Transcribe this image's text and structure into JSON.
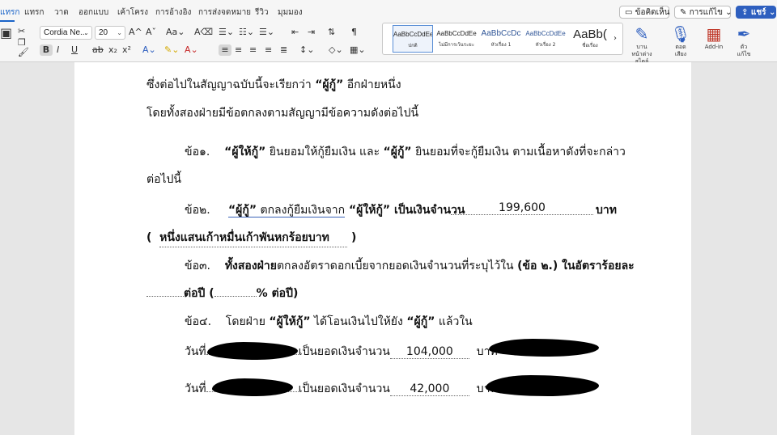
{
  "tabs": [
    "แทรก",
    "แทรก",
    "วาด",
    "ออกแบบ",
    "เค้าโครง",
    "การอ้างอิง",
    "การส่งจดหมาย",
    "รีวิว",
    "มุมมอง"
  ],
  "top_buttons": {
    "comments": "ข้อคิดเห็น",
    "editing": "การแก้ไข",
    "share": "แชร์"
  },
  "font": {
    "name": "Cordia Ne...",
    "size": "20"
  },
  "styles": [
    {
      "sample": "AaBbCcDdEe",
      "name": "ปกติ"
    },
    {
      "sample": "AaBbCcDdEe",
      "name": "ไม่มีการเว้นระยะ"
    },
    {
      "sample": "AaBbCcDc",
      "name": "หัวเรื่อง 1"
    },
    {
      "sample": "AaBbCcDdEe",
      "name": "หัวเรื่อง 2"
    },
    {
      "sample": "AaBb(",
      "name": "ชื่อเรื่อง"
    }
  ],
  "right_tools": {
    "pane": "บาน\nหน้าต่างสไตล์",
    "dictate": "ตอด\nเสียง",
    "addin": "Add-in",
    "editor": "ตัว\nแก้ไข"
  },
  "doc": {
    "l1_a": "ซึ่งต่อไปในสัญญาฉบับนี้จะเรียกว่า ",
    "l1_b": "“ผู้กู้”",
    "l1_c": " อีกฝ่ายหนึ่ง",
    "l2": "โดยทั้งสองฝ่ายมีข้อตกลงตามสัญญามีข้อความดังต่อไปนี้",
    "c1_num": "ข้อ๑.",
    "c1_a": "“ผู้ให้กู้”",
    "c1_b": " ยินยอมให้กู้ยืมเงิน และ ",
    "c1_c": "“ผู้กู้”",
    "c1_d": " ยินยอมที่จะกู้ยืมเงิน ตามเนื้อหาดังที่จะกล่าว",
    "c1_cont": "ต่อไปนี้",
    "c2_num": "ข้อ๒.",
    "c2_a": "“ผู้กู้”",
    "c2_b": "  ตกลงกู้ยืมเงินจาก",
    "c2_c": " “ผู้ให้กู้” เป็นเงินจำนวน",
    "c2_amount": "199,600",
    "c2_unit": "บาท",
    "c2_words_open": "(",
    "c2_words": "หนึ่งแสนเก้าหมื่นเก้าพันหกร้อยบาท",
    "c2_words_close": ")",
    "c3_num": "ข้อ๓.",
    "c3_a": "ทั้งสองฝ่าย",
    "c3_b": "ตกลงอัตราดอกเบี้ยจากยอดเงินจำนวนที่ระบุไว้ใน ",
    "c3_c": "(ข้อ ๒.) ในอัตราร้อยละ",
    "c3_d_a": "ต่อปี (",
    "c3_d_b": "% ต่อปี)",
    "c4_num": "ข้อ๔.",
    "c4_a": "โดยฝ่าย ",
    "c4_b": "“ผู้ให้กู้”",
    "c4_c": " ได้โอนเงินไปให้ยัง ",
    "c4_d": "“ผู้กู้”",
    "c4_e": " แล้วใน",
    "d1_a": "วันที่",
    "d1_b": "เป็นยอดเงินจำนวน",
    "d1_amount": "104,000",
    "d1_unit": "บาท",
    "d2_a": "วันที่",
    "d2_b": "เป็นยอดเงินจำนวน",
    "d2_amount": "42,000",
    "d2_unit": "บาท"
  }
}
